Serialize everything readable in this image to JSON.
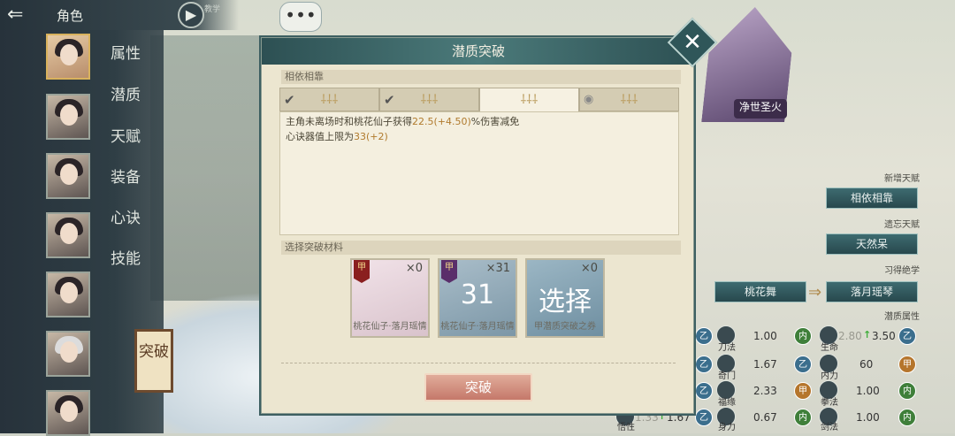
{
  "header": {
    "back_icon": "back-arrow-icon",
    "title": "角色",
    "tutorial_label": "教学"
  },
  "sidebar": {
    "menu": [
      {
        "label": "属性"
      },
      {
        "label": "潜质"
      },
      {
        "label": "天赋"
      },
      {
        "label": "装备"
      },
      {
        "label": "心诀"
      },
      {
        "label": "技能"
      }
    ],
    "breakthrough_label": "突破"
  },
  "right_panel": {
    "hero_name": "净世圣火",
    "new_talent_label": "新增天赋",
    "new_talent": "相依相靠",
    "forgotten_talent_label": "遗忘天赋",
    "forgotten_talent": "天然呆",
    "learned_skill_label": "习得绝学",
    "skill_from": "桃花舞",
    "skill_to": "落月瑶琴",
    "potential_attr_label": "潜质属性",
    "rows": [
      {
        "left_name": "刀法",
        "left_val": "1.00",
        "left_badge": "内",
        "right_name": "生命",
        "right_val_old": "2.80",
        "right_val_new": "3.50",
        "right_badge": "乙"
      },
      {
        "left_name": "奇门",
        "left_val": "1.67",
        "left_badge": "乙",
        "right_name": "内力",
        "right_val": "60",
        "right_badge": "甲"
      },
      {
        "left_name": "福缘",
        "left_val": "2.33",
        "left_badge": "甲",
        "right_name": "拳法",
        "right_val": "1.00",
        "right_badge": "内"
      },
      {
        "left_name": "悟性",
        "left_val_old": "1.33",
        "left_val_new": "1.67",
        "mid_name": "身力",
        "mid_val": "0.67",
        "mid_badge": "内",
        "right_name": "剑法",
        "right_val": "1.00",
        "right_badge": "内"
      }
    ]
  },
  "dialog": {
    "title": "潜质突破",
    "close_icon": "close-icon",
    "section1_title": "相依相靠",
    "tabs": [
      {
        "stars": "⸸⸸⸸",
        "state": "done"
      },
      {
        "stars": "⸸⸸⸸",
        "state": "done"
      },
      {
        "stars": "⸸⸸⸸",
        "state": "current"
      },
      {
        "stars": "⸸⸸⸸",
        "state": "preview"
      }
    ],
    "desc_line1_pre": "主角未离场时和桃花仙子获得",
    "desc_line1_val": "22.5(+4.50)",
    "desc_line1_post": "%伤害减免",
    "desc_line2_pre": "心诀器值上限为",
    "desc_line2_val": "33(+2)",
    "section2_title": "选择突破材料",
    "materials": [
      {
        "badge": "甲",
        "count": "×0",
        "name": "桃花仙子·落月瑶情"
      },
      {
        "badge": "甲",
        "count": "×31",
        "overlay": "31",
        "name": "桃花仙子·落月瑶情"
      },
      {
        "count": "×0",
        "overlay": "选择",
        "name": "甲潜质突破之券"
      }
    ],
    "confirm_label": "突破"
  }
}
